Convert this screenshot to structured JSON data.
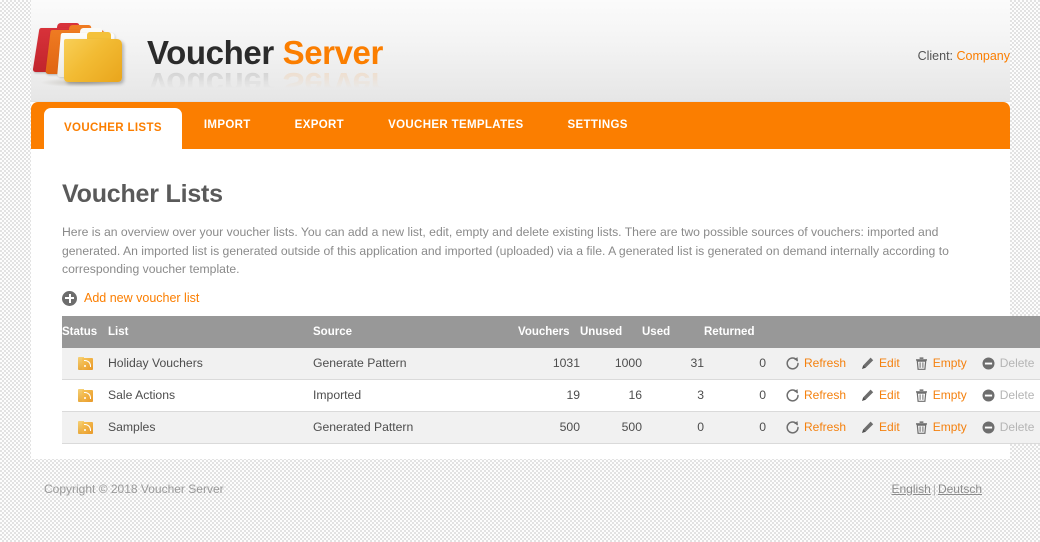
{
  "brand": {
    "name_part1": "Voucher",
    "name_part2": "Server",
    "logo_icon": "stacked-folders-icon",
    "accent_color": "#fb7e00",
    "header_gray": "#989898"
  },
  "header": {
    "client_label": "Client:",
    "client_name": "Company"
  },
  "tabs": [
    {
      "label": "VOUCHER LISTS",
      "active": true
    },
    {
      "label": "IMPORT",
      "active": false
    },
    {
      "label": "EXPORT",
      "active": false
    },
    {
      "label": "VOUCHER TEMPLATES",
      "active": false
    },
    {
      "label": "SETTINGS",
      "active": false
    }
  ],
  "main": {
    "title": "Voucher Lists",
    "description": "Here is an overview over your voucher lists. You can add a new list, edit, empty and delete existing lists. There are two possible sources of vouchers: imported and generated. An imported list is generated outside of this application and imported (uploaded) via a file. A generated list is generated on demand internally according to corresponding voucher template.",
    "add_new_label": "Add new voucher list",
    "add_new_icon": "plus-circle-icon"
  },
  "table": {
    "columns": [
      "Status",
      "List",
      "Source",
      "Vouchers",
      "Unused",
      "Used",
      "Returned"
    ],
    "rows": [
      {
        "status_icon": "folder-feed-icon",
        "list": "Holiday Vouchers",
        "source": "Generate Pattern",
        "vouchers": "1031",
        "unused": "1000",
        "used": "31",
        "returned": "0"
      },
      {
        "status_icon": "folder-feed-icon",
        "list": "Sale Actions",
        "source": "Imported",
        "vouchers": "19",
        "unused": "16",
        "used": "3",
        "returned": "0"
      },
      {
        "status_icon": "folder-feed-icon",
        "list": "Samples",
        "source": "Generated Pattern",
        "vouchers": "500",
        "unused": "500",
        "used": "0",
        "returned": "0"
      }
    ],
    "actions": {
      "refresh": {
        "label": "Refresh",
        "icon": "refresh-icon",
        "disabled": false
      },
      "edit": {
        "label": "Edit",
        "icon": "pencil-icon",
        "disabled": false
      },
      "empty": {
        "label": "Empty",
        "icon": "trash-icon",
        "disabled": false
      },
      "delete": {
        "label": "Delete",
        "icon": "minus-circle-icon",
        "disabled": true
      }
    }
  },
  "footer": {
    "copyright": "Copyright © 2018 Voucher Server",
    "lang_en": "English",
    "lang_sep": "|",
    "lang_de": "Deutsch"
  }
}
